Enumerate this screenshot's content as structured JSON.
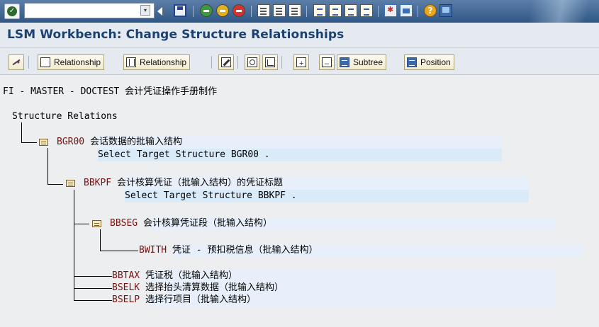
{
  "system_toolbar": {
    "command_field_value": "",
    "icons": [
      "enter-icon",
      "dropdown-icon",
      "back-triangle-icon",
      "save-icon",
      "back-icon",
      "exit-icon",
      "cancel-icon",
      "print-icon",
      "find-icon",
      "find-next-icon",
      "first-page-icon",
      "previous-page-icon",
      "next-page-icon",
      "last-page-icon",
      "new-session-icon",
      "shortcut-icon",
      "help-icon",
      "customize-layout-icon"
    ]
  },
  "title": "LSM Workbench: Change Structure Relationships",
  "app_toolbar": {
    "create_relationship": "Relationship",
    "delete_relationship": "Relationship",
    "subtree": "Subtree",
    "position": "Position"
  },
  "header_line": "FI - MASTER - DOCTEST 会计凭证操作手册制作",
  "tree": {
    "root": "Structure Relations",
    "nodes": [
      {
        "key": "BGR00",
        "desc": "会话数据的批输入结构",
        "sub": "Select Target Structure BGR00 ."
      },
      {
        "key": "BBKPF",
        "desc": "会计核算凭证（批输入结构）的凭证标题",
        "sub": "Select Target Structure BBKPF ."
      },
      {
        "key": "BBSEG",
        "desc": "会计核算凭证段（批输入结构）"
      },
      {
        "key": "BWITH",
        "desc": "凭证 - 预扣税信息（批输入结构）"
      },
      {
        "key": "BBTAX",
        "desc": "凭证税（批输入结构）"
      },
      {
        "key": "BSELK",
        "desc": "选择抬头清算数据（批输入结构）"
      },
      {
        "key": "BSELP",
        "desc": "选择行项目（批输入结构）"
      }
    ]
  },
  "colors": {
    "toolbar_top": "#5C7FA9",
    "title_text": "#1C4170",
    "key_text": "#7A1010",
    "row_band": "#E7F0FA"
  }
}
